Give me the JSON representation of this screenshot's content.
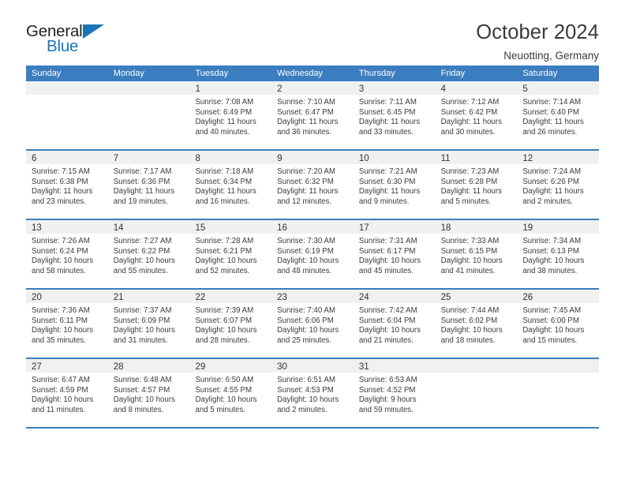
{
  "brand": {
    "name_top": "General",
    "name_bottom": "Blue",
    "triangle_color": "#1b75bb"
  },
  "header": {
    "title": "October 2024",
    "subtitle": "Neuotting, Germany"
  },
  "theme": {
    "header_blue": "#3a7ebf",
    "daynum_band": "#f0f0f0",
    "text": "#3b3b3b"
  },
  "calendar": {
    "weekday_headers": [
      "Sunday",
      "Monday",
      "Tuesday",
      "Wednesday",
      "Thursday",
      "Friday",
      "Saturday"
    ],
    "labels": {
      "sunrise": "Sunrise:",
      "sunset": "Sunset:",
      "daylight": "Daylight:"
    },
    "weeks": [
      [
        {
          "day": "",
          "sunrise": "",
          "sunset": "",
          "daylight_line1": "",
          "daylight_line2": ""
        },
        {
          "day": "",
          "sunrise": "",
          "sunset": "",
          "daylight_line1": "",
          "daylight_line2": ""
        },
        {
          "day": "1",
          "sunrise": "Sunrise: 7:08 AM",
          "sunset": "Sunset: 6:49 PM",
          "daylight_line1": "Daylight: 11 hours",
          "daylight_line2": "and 40 minutes."
        },
        {
          "day": "2",
          "sunrise": "Sunrise: 7:10 AM",
          "sunset": "Sunset: 6:47 PM",
          "daylight_line1": "Daylight: 11 hours",
          "daylight_line2": "and 36 minutes."
        },
        {
          "day": "3",
          "sunrise": "Sunrise: 7:11 AM",
          "sunset": "Sunset: 6:45 PM",
          "daylight_line1": "Daylight: 11 hours",
          "daylight_line2": "and 33 minutes."
        },
        {
          "day": "4",
          "sunrise": "Sunrise: 7:12 AM",
          "sunset": "Sunset: 6:42 PM",
          "daylight_line1": "Daylight: 11 hours",
          "daylight_line2": "and 30 minutes."
        },
        {
          "day": "5",
          "sunrise": "Sunrise: 7:14 AM",
          "sunset": "Sunset: 6:40 PM",
          "daylight_line1": "Daylight: 11 hours",
          "daylight_line2": "and 26 minutes."
        }
      ],
      [
        {
          "day": "6",
          "sunrise": "Sunrise: 7:15 AM",
          "sunset": "Sunset: 6:38 PM",
          "daylight_line1": "Daylight: 11 hours",
          "daylight_line2": "and 23 minutes."
        },
        {
          "day": "7",
          "sunrise": "Sunrise: 7:17 AM",
          "sunset": "Sunset: 6:36 PM",
          "daylight_line1": "Daylight: 11 hours",
          "daylight_line2": "and 19 minutes."
        },
        {
          "day": "8",
          "sunrise": "Sunrise: 7:18 AM",
          "sunset": "Sunset: 6:34 PM",
          "daylight_line1": "Daylight: 11 hours",
          "daylight_line2": "and 16 minutes."
        },
        {
          "day": "9",
          "sunrise": "Sunrise: 7:20 AM",
          "sunset": "Sunset: 6:32 PM",
          "daylight_line1": "Daylight: 11 hours",
          "daylight_line2": "and 12 minutes."
        },
        {
          "day": "10",
          "sunrise": "Sunrise: 7:21 AM",
          "sunset": "Sunset: 6:30 PM",
          "daylight_line1": "Daylight: 11 hours",
          "daylight_line2": "and 9 minutes."
        },
        {
          "day": "11",
          "sunrise": "Sunrise: 7:23 AM",
          "sunset": "Sunset: 6:28 PM",
          "daylight_line1": "Daylight: 11 hours",
          "daylight_line2": "and 5 minutes."
        },
        {
          "day": "12",
          "sunrise": "Sunrise: 7:24 AM",
          "sunset": "Sunset: 6:26 PM",
          "daylight_line1": "Daylight: 11 hours",
          "daylight_line2": "and 2 minutes."
        }
      ],
      [
        {
          "day": "13",
          "sunrise": "Sunrise: 7:26 AM",
          "sunset": "Sunset: 6:24 PM",
          "daylight_line1": "Daylight: 10 hours",
          "daylight_line2": "and 58 minutes."
        },
        {
          "day": "14",
          "sunrise": "Sunrise: 7:27 AM",
          "sunset": "Sunset: 6:22 PM",
          "daylight_line1": "Daylight: 10 hours",
          "daylight_line2": "and 55 minutes."
        },
        {
          "day": "15",
          "sunrise": "Sunrise: 7:28 AM",
          "sunset": "Sunset: 6:21 PM",
          "daylight_line1": "Daylight: 10 hours",
          "daylight_line2": "and 52 minutes."
        },
        {
          "day": "16",
          "sunrise": "Sunrise: 7:30 AM",
          "sunset": "Sunset: 6:19 PM",
          "daylight_line1": "Daylight: 10 hours",
          "daylight_line2": "and 48 minutes."
        },
        {
          "day": "17",
          "sunrise": "Sunrise: 7:31 AM",
          "sunset": "Sunset: 6:17 PM",
          "daylight_line1": "Daylight: 10 hours",
          "daylight_line2": "and 45 minutes."
        },
        {
          "day": "18",
          "sunrise": "Sunrise: 7:33 AM",
          "sunset": "Sunset: 6:15 PM",
          "daylight_line1": "Daylight: 10 hours",
          "daylight_line2": "and 41 minutes."
        },
        {
          "day": "19",
          "sunrise": "Sunrise: 7:34 AM",
          "sunset": "Sunset: 6:13 PM",
          "daylight_line1": "Daylight: 10 hours",
          "daylight_line2": "and 38 minutes."
        }
      ],
      [
        {
          "day": "20",
          "sunrise": "Sunrise: 7:36 AM",
          "sunset": "Sunset: 6:11 PM",
          "daylight_line1": "Daylight: 10 hours",
          "daylight_line2": "and 35 minutes."
        },
        {
          "day": "21",
          "sunrise": "Sunrise: 7:37 AM",
          "sunset": "Sunset: 6:09 PM",
          "daylight_line1": "Daylight: 10 hours",
          "daylight_line2": "and 31 minutes."
        },
        {
          "day": "22",
          "sunrise": "Sunrise: 7:39 AM",
          "sunset": "Sunset: 6:07 PM",
          "daylight_line1": "Daylight: 10 hours",
          "daylight_line2": "and 28 minutes."
        },
        {
          "day": "23",
          "sunrise": "Sunrise: 7:40 AM",
          "sunset": "Sunset: 6:06 PM",
          "daylight_line1": "Daylight: 10 hours",
          "daylight_line2": "and 25 minutes."
        },
        {
          "day": "24",
          "sunrise": "Sunrise: 7:42 AM",
          "sunset": "Sunset: 6:04 PM",
          "daylight_line1": "Daylight: 10 hours",
          "daylight_line2": "and 21 minutes."
        },
        {
          "day": "25",
          "sunrise": "Sunrise: 7:44 AM",
          "sunset": "Sunset: 6:02 PM",
          "daylight_line1": "Daylight: 10 hours",
          "daylight_line2": "and 18 minutes."
        },
        {
          "day": "26",
          "sunrise": "Sunrise: 7:45 AM",
          "sunset": "Sunset: 6:00 PM",
          "daylight_line1": "Daylight: 10 hours",
          "daylight_line2": "and 15 minutes."
        }
      ],
      [
        {
          "day": "27",
          "sunrise": "Sunrise: 6:47 AM",
          "sunset": "Sunset: 4:59 PM",
          "daylight_line1": "Daylight: 10 hours",
          "daylight_line2": "and 11 minutes."
        },
        {
          "day": "28",
          "sunrise": "Sunrise: 6:48 AM",
          "sunset": "Sunset: 4:57 PM",
          "daylight_line1": "Daylight: 10 hours",
          "daylight_line2": "and 8 minutes."
        },
        {
          "day": "29",
          "sunrise": "Sunrise: 6:50 AM",
          "sunset": "Sunset: 4:55 PM",
          "daylight_line1": "Daylight: 10 hours",
          "daylight_line2": "and 5 minutes."
        },
        {
          "day": "30",
          "sunrise": "Sunrise: 6:51 AM",
          "sunset": "Sunset: 4:53 PM",
          "daylight_line1": "Daylight: 10 hours",
          "daylight_line2": "and 2 minutes."
        },
        {
          "day": "31",
          "sunrise": "Sunrise: 6:53 AM",
          "sunset": "Sunset: 4:52 PM",
          "daylight_line1": "Daylight: 9 hours",
          "daylight_line2": "and 59 minutes."
        },
        {
          "day": "",
          "sunrise": "",
          "sunset": "",
          "daylight_line1": "",
          "daylight_line2": ""
        },
        {
          "day": "",
          "sunrise": "",
          "sunset": "",
          "daylight_line1": "",
          "daylight_line2": ""
        }
      ]
    ]
  }
}
